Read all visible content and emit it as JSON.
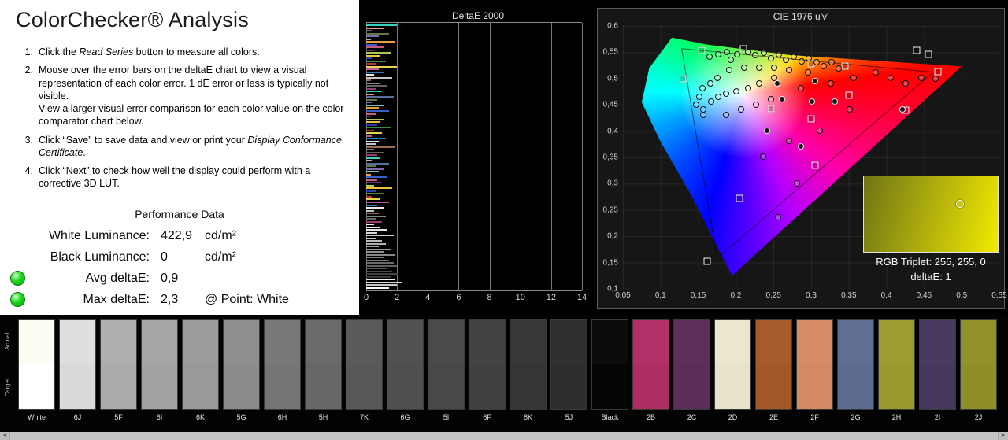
{
  "left_panel": {
    "title": "ColorChecker® Analysis",
    "instructions": [
      [
        {
          "t": "Click the "
        },
        {
          "t": "Read Series",
          "i": true
        },
        {
          "t": " button to measure all colors."
        }
      ],
      [
        {
          "t": "Mouse over the error bars on the deltaE chart to view a visual representation of each color error. 1 dE error or less is typically not visible.\nView a larger visual error comparison for each color value on the color comparator chart below."
        }
      ],
      [
        {
          "t": "Click “Save” to save data and view or print your "
        },
        {
          "t": "Display Conformance Certificate",
          "i": true
        },
        {
          "t": "."
        }
      ],
      [
        {
          "t": "Click “Next” to check how well the display could perform with a corrective 3D LUT."
        }
      ]
    ],
    "performance": {
      "heading": "Performance Data",
      "dot_color": "#1fd41f",
      "rows": [
        {
          "label": "White Luminance:",
          "value": "422,9",
          "unit": "cd/m²",
          "dot": false
        },
        {
          "label": "Black Luminance:",
          "value": "0",
          "unit": "cd/m²",
          "dot": false
        },
        {
          "label": "Avg deltaE:",
          "value": "0,9",
          "unit": "",
          "dot": true
        },
        {
          "label": "Max deltaE:",
          "value": "2,3",
          "unit": "@ Point: White",
          "dot": true
        }
      ]
    }
  },
  "chart_data": [
    {
      "type": "bar",
      "title": "DeltaE 2000",
      "orientation": "horizontal",
      "xlabel": "",
      "ylabel": "",
      "xlim": [
        0,
        14
      ],
      "xticks": [
        "0",
        "2",
        "4",
        "6",
        "8",
        "10",
        "12",
        "14"
      ],
      "values": [
        2.0,
        1.1,
        0.4,
        1.5,
        0.8,
        0.3,
        1.9,
        0.7,
        1.2,
        0.5,
        1.6,
        0.9,
        0.4,
        1.3,
        0.6,
        2.0,
        0.8,
        1.1,
        0.5,
        1.7,
        0.3,
        0.9,
        1.4,
        0.6,
        1.0,
        0.5,
        1.8,
        0.7,
        0.4,
        1.2,
        0.8,
        1.5,
        0.6,
        0.3,
        1.1,
        0.9,
        0.7,
        1.6,
        0.5,
        1.0,
        0.4,
        1.3,
        0.8,
        0.6,
        1.9,
        0.5,
        1.2,
        0.7,
        0.9,
        0.4,
        1.5,
        0.6,
        1.1,
        0.8,
        0.3,
        1.4,
        0.7,
        1.0,
        0.5,
        1.7,
        0.6,
        1.2,
        0.4,
        0.9,
        1.5,
        0.7,
        1.1,
        0.5,
        0.8,
        1.3,
        0.6,
        1.0,
        0.5,
        0.9,
        1.4,
        0.7,
        1.8,
        0.6,
        1.0,
        1.3,
        0.8,
        1.6,
        1.1,
        1.9,
        1.2,
        1.5,
        1.8,
        2.0,
        1.4,
        1.7,
        2.1,
        1.6,
        1.9,
        2.3,
        2.0,
        1.5
      ],
      "colors": [
        "#35d0c0",
        "#d99e84",
        "#5a6e9e",
        "#5d7a44",
        "#7a6aae",
        "#8fc0ae",
        "#e8a23c",
        "#3a5ec8",
        "#c85a80",
        "#582d68",
        "#aac84c",
        "#e8c23e",
        "#2a3ca8",
        "#3e8a46",
        "#b03634",
        "#e8d44c",
        "#bc5a96",
        "#2a7ec0",
        "#e8e8e4",
        "#c4c4c4",
        "#9a6a52",
        "#848484",
        "#646464",
        "#9c3a78",
        "#35d0c0",
        "#d99e84",
        "#5a6e9e",
        "#5d7a44",
        "#7a6aae",
        "#8fc0ae",
        "#e8a23c",
        "#3a5ec8",
        "#c85a80",
        "#582d68",
        "#aac84c",
        "#e8c23e",
        "#2a3ca8",
        "#3e8a46",
        "#b03634",
        "#e8d44c",
        "#bc5a96",
        "#2a7ec0",
        "#e8e8e4",
        "#c4c4c4",
        "#9a6a52",
        "#848484",
        "#646464",
        "#9c3a78",
        "#35d0c0",
        "#d99e84",
        "#5a6e9e",
        "#5d7a44",
        "#7a6aae",
        "#8fc0ae",
        "#e8a23c",
        "#3a5ec8",
        "#c85a80",
        "#582d68",
        "#aac84c",
        "#e8c23e",
        "#2a3ca8",
        "#3e8a46",
        "#b03634",
        "#e8d44c",
        "#bc5a96",
        "#2a7ec0",
        "#e8e8e4",
        "#c4c4c4",
        "#9a6a52",
        "#848484",
        "#646464",
        "#9c3a78",
        "#f6f6f6",
        "#ececec",
        "#e2e2e2",
        "#d8d8d8",
        "#cecece",
        "#c4c4c4",
        "#bababa",
        "#b0b0b0",
        "#a6a6a6",
        "#9c9c9c",
        "#929292",
        "#888888",
        "#7e7e7e",
        "#747474",
        "#6a6a6a",
        "#606060",
        "#565656",
        "#4c4c4c",
        "#424242",
        "#383838",
        "#f0f0f0",
        "#dcdcdc",
        "#c8c8c8",
        "#fafafa"
      ]
    },
    {
      "type": "scatter",
      "title": "CIE 1976 u'v'",
      "xlim": [
        0.05,
        0.55
      ],
      "ylim": [
        0.1,
        0.6
      ],
      "xticks": [
        "0,05",
        "0,1",
        "0,15",
        "0,2",
        "0,25",
        "0,3",
        "0,35",
        "0,4",
        "0,45",
        "0,5",
        "0,55"
      ],
      "yticks": [
        "0,6",
        "0,55",
        "0,5",
        "0,45",
        "0,4",
        "0,35",
        "0,3",
        "0,25",
        "0,2",
        "0,15",
        "0,1"
      ],
      "gamut_polygon_uv": [
        [
          0.115,
          0.578
        ],
        [
          0.16,
          0.565
        ],
        [
          0.27,
          0.545
        ],
        [
          0.5,
          0.523
        ],
        [
          0.195,
          0.125
        ],
        [
          0.14,
          0.28
        ],
        [
          0.1,
          0.38
        ],
        [
          0.075,
          0.455
        ],
        [
          0.085,
          0.52
        ]
      ],
      "target_triangle_uv": [
        [
          0.128,
          0.557
        ],
        [
          0.462,
          0.512
        ],
        [
          0.175,
          0.158
        ]
      ],
      "points": [
        [
          0.155,
          0.553,
          "s"
        ],
        [
          0.21,
          0.557,
          "s"
        ],
        [
          0.3,
          0.528,
          "s"
        ],
        [
          0.345,
          0.523,
          "s"
        ],
        [
          0.44,
          0.554,
          "s"
        ],
        [
          0.456,
          0.546,
          "s"
        ],
        [
          0.468,
          0.513,
          "s"
        ],
        [
          0.35,
          0.468,
          "s"
        ],
        [
          0.3,
          0.423,
          "s"
        ],
        [
          0.247,
          0.443,
          "s"
        ],
        [
          0.305,
          0.335,
          "s"
        ],
        [
          0.205,
          0.272,
          "s"
        ],
        [
          0.162,
          0.152,
          "s"
        ],
        [
          0.425,
          0.44,
          "s"
        ],
        [
          0.13,
          0.5,
          "s"
        ],
        [
          0.165,
          0.541,
          "c"
        ],
        [
          0.177,
          0.546,
          "c"
        ],
        [
          0.188,
          0.551,
          "c"
        ],
        [
          0.193,
          0.536,
          "c"
        ],
        [
          0.202,
          0.546,
          "c"
        ],
        [
          0.216,
          0.551,
          "c"
        ],
        [
          0.226,
          0.544,
          "c"
        ],
        [
          0.237,
          0.549,
          "c"
        ],
        [
          0.247,
          0.539,
          "c"
        ],
        [
          0.257,
          0.546,
          "c"
        ],
        [
          0.267,
          0.536,
          "c"
        ],
        [
          0.277,
          0.541,
          "c"
        ],
        [
          0.287,
          0.533,
          "c"
        ],
        [
          0.297,
          0.539,
          "c"
        ],
        [
          0.307,
          0.531,
          "c"
        ],
        [
          0.317,
          0.523,
          "c"
        ],
        [
          0.327,
          0.531,
          "c"
        ],
        [
          0.337,
          0.519,
          "c"
        ],
        [
          0.296,
          0.511,
          "c"
        ],
        [
          0.271,
          0.516,
          "c"
        ],
        [
          0.251,
          0.521,
          "c"
        ],
        [
          0.231,
          0.521,
          "c"
        ],
        [
          0.211,
          0.521,
          "c"
        ],
        [
          0.191,
          0.516,
          "c"
        ],
        [
          0.176,
          0.501,
          "c"
        ],
        [
          0.166,
          0.491,
          "c"
        ],
        [
          0.156,
          0.481,
          "c"
        ],
        [
          0.151,
          0.466,
          "c"
        ],
        [
          0.147,
          0.451,
          "c"
        ],
        [
          0.157,
          0.441,
          "c"
        ],
        [
          0.167,
          0.456,
          "c"
        ],
        [
          0.177,
          0.466,
          "c"
        ],
        [
          0.187,
          0.471,
          "c"
        ],
        [
          0.201,
          0.476,
          "c"
        ],
        [
          0.216,
          0.481,
          "c"
        ],
        [
          0.231,
          0.491,
          "c"
        ],
        [
          0.251,
          0.501,
          "c"
        ],
        [
          0.157,
          0.431,
          "c"
        ],
        [
          0.187,
          0.431,
          "c"
        ],
        [
          0.207,
          0.441,
          "c"
        ],
        [
          0.227,
          0.451,
          "c"
        ],
        [
          0.247,
          0.461,
          "c"
        ],
        [
          0.286,
          0.481,
          "c"
        ],
        [
          0.326,
          0.491,
          "c"
        ],
        [
          0.356,
          0.501,
          "c"
        ],
        [
          0.386,
          0.511,
          "c"
        ],
        [
          0.406,
          0.501,
          "c"
        ],
        [
          0.426,
          0.491,
          "c"
        ],
        [
          0.446,
          0.501,
          "c"
        ],
        [
          0.465,
          0.499,
          "c"
        ],
        [
          0.351,
          0.441,
          "c"
        ],
        [
          0.311,
          0.401,
          "c"
        ],
        [
          0.271,
          0.381,
          "c"
        ],
        [
          0.236,
          0.351,
          "c"
        ],
        [
          0.281,
          0.301,
          "c"
        ],
        [
          0.256,
          0.236,
          "c"
        ],
        [
          0.261,
          0.461,
          "d"
        ],
        [
          0.301,
          0.456,
          "d"
        ],
        [
          0.241,
          0.401,
          "d"
        ],
        [
          0.286,
          0.371,
          "d"
        ],
        [
          0.331,
          0.456,
          "d"
        ],
        [
          0.421,
          0.441,
          "d"
        ],
        [
          0.305,
          0.495,
          "d"
        ],
        [
          0.255,
          0.49,
          "d"
        ]
      ]
    }
  ],
  "tooltip": {
    "rgb_label": "RGB Triplet: 255, 255, 0",
    "deltae_label": "deltaE: 1",
    "swatch_dark": "#6e7513",
    "swatch_mid": "#aaa90e",
    "swatch_bright": "#f2ea00"
  },
  "comparator": {
    "actual_label": "Actual",
    "target_label": "Target",
    "patches": [
      {
        "label": "White",
        "a": "#fdfdf4",
        "t": "#ffffff"
      },
      {
        "label": "6J",
        "a": "#dedede",
        "t": "#dadada"
      },
      {
        "label": "5F",
        "a": "#aeaeae",
        "t": "#ababab"
      },
      {
        "label": "6I",
        "a": "#a6a6a6",
        "t": "#a3a3a3"
      },
      {
        "label": "6K",
        "a": "#9c9c9c",
        "t": "#999999"
      },
      {
        "label": "5G",
        "a": "#8e8e8e",
        "t": "#8b8b8b"
      },
      {
        "label": "6H",
        "a": "#787878",
        "t": "#757575"
      },
      {
        "label": "5H",
        "a": "#6a6a6a",
        "t": "#676767"
      },
      {
        "label": "7K",
        "a": "#5a5a5a",
        "t": "#585858"
      },
      {
        "label": "6G",
        "a": "#515151",
        "t": "#4f4f4f"
      },
      {
        "label": "5I",
        "a": "#4a4a4a",
        "t": "#484848"
      },
      {
        "label": "6F",
        "a": "#434343",
        "t": "#414141"
      },
      {
        "label": "8K",
        "a": "#373737",
        "t": "#353535"
      },
      {
        "label": "5J",
        "a": "#303030",
        "t": "#2e2e2e"
      },
      {
        "label": "Black",
        "a": "#0c0c0c",
        "t": "#050505"
      },
      {
        "label": "2B",
        "a": "#b23067",
        "t": "#ae2e64"
      },
      {
        "label": "2C",
        "a": "#5e2f5b",
        "t": "#5b2d58"
      },
      {
        "label": "2D",
        "a": "#ebe6cc",
        "t": "#e8e3c8"
      },
      {
        "label": "2E",
        "a": "#a65b2b",
        "t": "#a35828"
      },
      {
        "label": "2F",
        "a": "#d78c68",
        "t": "#d48965"
      },
      {
        "label": "2G",
        "a": "#5f6f93",
        "t": "#5c6c90"
      },
      {
        "label": "2H",
        "a": "#9c9d31",
        "t": "#999a2e"
      },
      {
        "label": "2I",
        "a": "#483b5f",
        "t": "#45385c"
      },
      {
        "label": "2J",
        "a": "#91932a",
        "t": "#8e9027"
      }
    ]
  },
  "scrollbar": {
    "left_glyph": "◄",
    "right_glyph": "►"
  }
}
